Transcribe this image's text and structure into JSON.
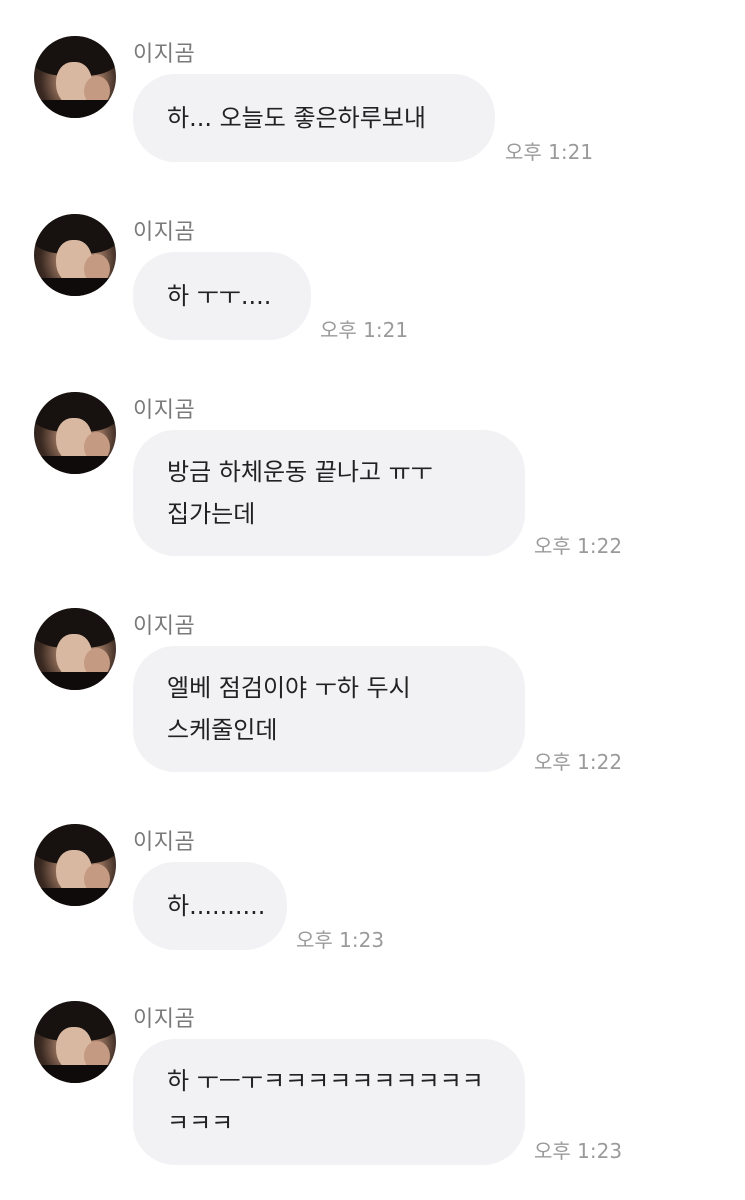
{
  "messages": [
    {
      "sender": "이지곰",
      "lines": [
        "하... 오늘도 좋은하루보내"
      ],
      "time": "오후 1:21"
    },
    {
      "sender": "이지곰",
      "lines": [
        "하 ㅜㅜ...."
      ],
      "time": "오후 1:21"
    },
    {
      "sender": "이지곰",
      "lines": [
        "방금 하체운동 끝나고 ㅠㅜ",
        "집가는데"
      ],
      "time": "오후 1:22"
    },
    {
      "sender": "이지곰",
      "lines": [
        "엘베 점검이야 ㅜ하 두시",
        "스케줄인데"
      ],
      "time": "오후 1:22"
    },
    {
      "sender": "이지곰",
      "lines": [
        "하.........."
      ],
      "time": "오후 1:23"
    },
    {
      "sender": "이지곰",
      "lines": [
        "하 ㅜㅡㅜㅋㅋㅋㅋㅋㅋㅋㅋㅋㅋ",
        "ㅋㅋㅋ"
      ],
      "time": "오후 1:23"
    }
  ]
}
